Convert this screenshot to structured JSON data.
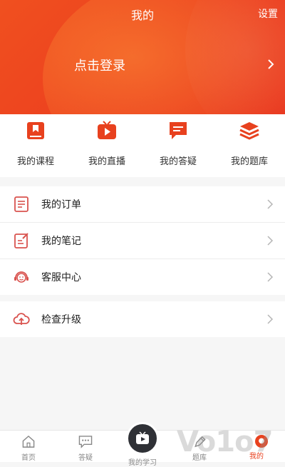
{
  "header": {
    "title": "我的",
    "settings_label": "设置",
    "login_label": "点击登录"
  },
  "shortcuts": [
    {
      "label": "我的课程",
      "icon": "bookmark-book-icon"
    },
    {
      "label": "我的直播",
      "icon": "tv-play-icon"
    },
    {
      "label": "我的答疑",
      "icon": "chat-bubble-icon"
    },
    {
      "label": "我的题库",
      "icon": "layers-stack-icon"
    }
  ],
  "menu": {
    "group1": [
      {
        "label": "我的订单",
        "icon": "order-list-icon"
      },
      {
        "label": "我的笔记",
        "icon": "note-edit-icon"
      },
      {
        "label": "客服中心",
        "icon": "customer-service-icon"
      }
    ],
    "group2": [
      {
        "label": "检查升级",
        "icon": "cloud-upload-icon"
      }
    ]
  },
  "tabbar": {
    "tabs": [
      {
        "label": "首页",
        "icon": "home-icon"
      },
      {
        "label": "答疑",
        "icon": "chat-dots-icon"
      },
      {
        "label": "我的学习",
        "icon": "tv-play-icon"
      },
      {
        "label": "题库",
        "icon": "pen-icon"
      },
      {
        "label": "我的",
        "icon": "user-icon"
      }
    ],
    "active_index": 4
  },
  "watermark": "Vo1o7",
  "colors": {
    "brand_red": "#e8411e",
    "header_orange": "#f0501f",
    "menu_icon": "#d9534f"
  }
}
